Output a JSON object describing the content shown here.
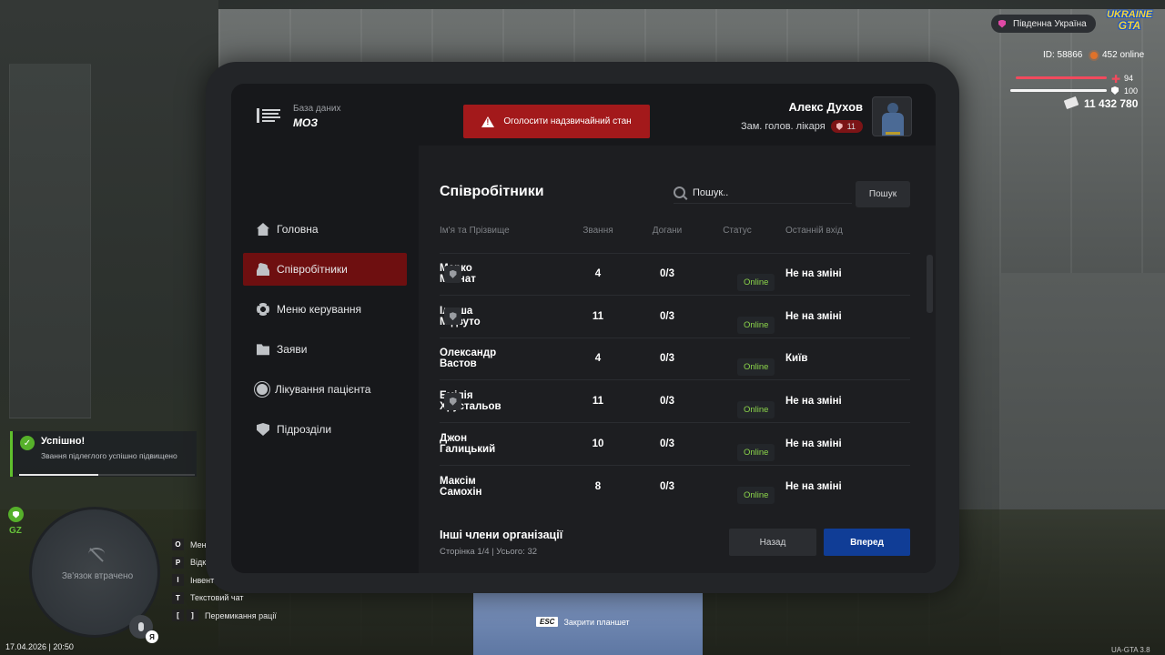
{
  "colors": {
    "accent_red": "#a3191b",
    "nav_active": "#6e0f10",
    "primary_blue": "#103d96",
    "online_green": "#8bd44a",
    "success_green": "#56b02a"
  },
  "header": {
    "brand_sub": "База даних",
    "brand_main": "МОЗ",
    "emergency_label": "Оголосити надзвичайний стан",
    "user_name": "Алекс Духов",
    "user_role": "Зам. голов. лікаря",
    "user_rank": "11"
  },
  "sidebar": {
    "items": [
      {
        "label": "Головна",
        "icon": "home-icon"
      },
      {
        "label": "Співробітники",
        "icon": "people-icon",
        "active": true
      },
      {
        "label": "Меню керування",
        "icon": "gear-icon"
      },
      {
        "label": "Заяви",
        "icon": "folder-icon"
      },
      {
        "label": "Лікування пацієнта",
        "icon": "virus-icon"
      },
      {
        "label": "Підрозділи",
        "icon": "shield-icon"
      }
    ]
  },
  "main": {
    "title": "Співробітники",
    "search_placeholder": "Пошук..",
    "search_button": "Пошук",
    "columns": {
      "name": "Ім'я та Прізвище",
      "rank": "Звання",
      "reprimands": "Догани",
      "status": "Статус",
      "last_login": "Останній вхід"
    },
    "rows": [
      {
        "name": "Марко Магнат",
        "badge": true,
        "rank": "4",
        "reprimands": "0/3",
        "status": "Online",
        "last": "Не на зміні"
      },
      {
        "name": "Ілюша Мідзуто",
        "badge": true,
        "rank": "11",
        "reprimands": "0/3",
        "status": "Online",
        "last": "Не на зміні"
      },
      {
        "name": "Олександр Вастов",
        "badge": false,
        "rank": "4",
        "reprimands": "0/3",
        "status": "Online",
        "last": "Київ"
      },
      {
        "name": "Емілія Хрустальов",
        "badge": true,
        "rank": "11",
        "reprimands": "0/3",
        "status": "Online",
        "last": "Не на зміні"
      },
      {
        "name": "Джон Галицький",
        "badge": false,
        "rank": "10",
        "reprimands": "0/3",
        "status": "Online",
        "last": "Не на зміні"
      },
      {
        "name": "Максім Самохін",
        "badge": false,
        "rank": "8",
        "reprimands": "0/3",
        "status": "Online",
        "last": "Не на зміні"
      }
    ],
    "footer_title": "Інші члени організації",
    "footer_sub": "Сторінка 1/4 | Усього: 32",
    "back_button": "Назад",
    "next_button": "Вперед"
  },
  "hud": {
    "server_name": "Південна Україна",
    "logo_line1": "UKRAINE",
    "logo_line2": "GTA",
    "player_id": "ID: 58866",
    "online": "452 online",
    "health": "94",
    "armor": "100",
    "money": "11 432 780",
    "toast_title": "Успішно!",
    "toast_text": "Звання підлеглого успішно підвищено",
    "toast_progress": 0.45,
    "zone": "GZ",
    "minimap_text": "Зв'язок втрачено",
    "mic_key": "Я",
    "keybinds": [
      {
        "key": "O",
        "label": "Мен"
      },
      {
        "key": "P",
        "label": "Відк"
      },
      {
        "key": "I",
        "label": "Інвент"
      },
      {
        "key": "T",
        "label": "Текстовий чат"
      },
      {
        "key": "[",
        "key2": "]",
        "label": "Перемикання рації"
      }
    ],
    "datetime": "17.04.2026 | 20:50",
    "esc_key": "ESC",
    "esc_label": "Закрити планшет",
    "version": "UA-GTA 3.8"
  }
}
